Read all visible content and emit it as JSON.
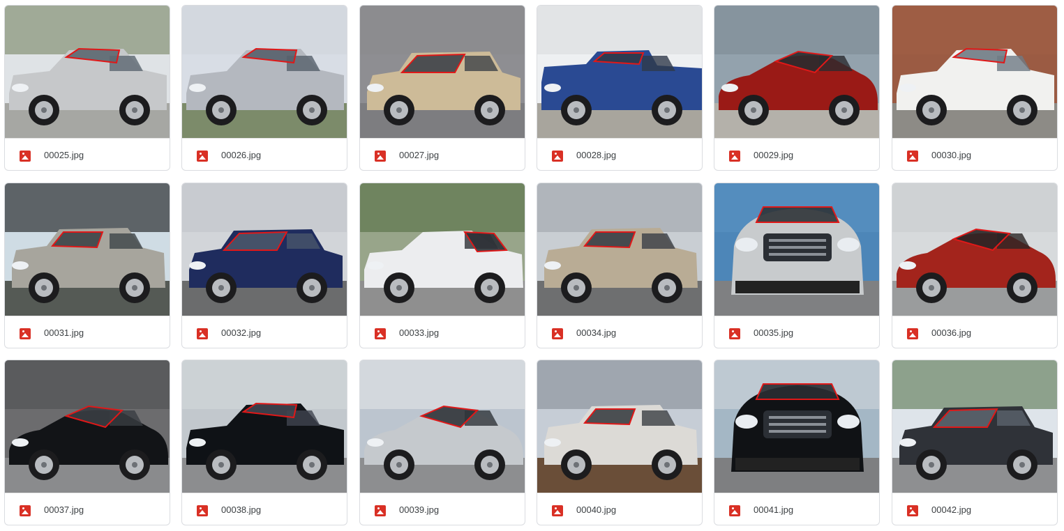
{
  "files": [
    {
      "name": "00025.jpg",
      "file_icon": "image-file-icon",
      "scene": {
        "sky": "#dfe3e6",
        "ground": "#a6a7a3",
        "body": "#c6c8ca",
        "glass": "#5b6770",
        "kind": "sedan",
        "bg": "#6c7b55"
      }
    },
    {
      "name": "00026.jpg",
      "file_icon": "image-file-icon",
      "scene": {
        "sky": "#d8dde5",
        "ground": "#7c8b6a",
        "body": "#b4b8bf",
        "glass": "#56606c",
        "kind": "sedan",
        "bg": "#cfd4da"
      }
    },
    {
      "name": "00027.jpg",
      "file_icon": "image-file-icon",
      "scene": {
        "sky": "#8e8e92",
        "ground": "#7d7d80",
        "body": "#cdbb98",
        "glass": "#3e4349",
        "kind": "hatch",
        "bg": "#8a8a8d"
      }
    },
    {
      "name": "00028.jpg",
      "file_icon": "image-file-icon",
      "scene": {
        "sky": "#eef0f2",
        "ground": "#a8a59d",
        "body": "#2a4a93",
        "glass": "#2f3a4a",
        "kind": "truck",
        "bg": "#d9dbdc"
      }
    },
    {
      "name": "00029.jpg",
      "file_icon": "image-file-icon",
      "scene": {
        "sky": "#93a2ad",
        "ground": "#b4b1aa",
        "body": "#9a1a16",
        "glass": "#2a2b2e",
        "kind": "sport",
        "bg": "#7c8891"
      }
    },
    {
      "name": "00030.jpg",
      "file_icon": "image-file-icon",
      "scene": {
        "sky": "#9b5b43",
        "ground": "#8d8b86",
        "body": "#f1f1ef",
        "glass": "#6f7b84",
        "kind": "sedan",
        "bg": "#a05e45"
      }
    },
    {
      "name": "00031.jpg",
      "file_icon": "image-file-icon",
      "scene": {
        "sky": "#cfdce4",
        "ground": "#555a55",
        "body": "#a7a59d",
        "glass": "#3d4548",
        "kind": "suv",
        "bg": "#000000"
      }
    },
    {
      "name": "00032.jpg",
      "file_icon": "image-file-icon",
      "scene": {
        "sky": "#d2d5d9",
        "ground": "#6b6c6d",
        "body": "#1f2c5e",
        "glass": "#49566a",
        "kind": "hatch",
        "bg": "#bfc3c8"
      }
    },
    {
      "name": "00033.jpg",
      "file_icon": "image-file-icon",
      "scene": {
        "sky": "#98a58a",
        "ground": "#8f8f8f",
        "body": "#ecedef",
        "glass": "#2e3136",
        "kind": "coupe",
        "bg": "#4f6a3d"
      }
    },
    {
      "name": "00034.jpg",
      "file_icon": "image-file-icon",
      "scene": {
        "sky": "#c9ced3",
        "ground": "#6e6f70",
        "body": "#b9ac95",
        "glass": "#3a3f46",
        "kind": "suv",
        "bg": "#9aa1a8"
      }
    },
    {
      "name": "00035.jpg",
      "file_icon": "image-file-icon",
      "scene": {
        "sky": "#4d86b8",
        "ground": "#7f8082",
        "body": "#c8cbcd",
        "glass": "#2f3439",
        "kind": "front",
        "bg": "#5b93c2"
      }
    },
    {
      "name": "00036.jpg",
      "file_icon": "image-file-icon",
      "scene": {
        "sky": "#d7dadc",
        "ground": "#9a9c9d",
        "body": "#a3241c",
        "glass": "#2a2526",
        "kind": "sport",
        "bg": "#c8ccce"
      }
    },
    {
      "name": "00037.jpg",
      "file_icon": "image-file-icon",
      "scene": {
        "sky": "#6c6c6e",
        "ground": "#8a8b8d",
        "body": "#121417",
        "glass": "#3a3d42",
        "kind": "roadster",
        "bg": "#4d4e50"
      }
    },
    {
      "name": "00038.jpg",
      "file_icon": "image-file-icon",
      "scene": {
        "sky": "#c2c8cd",
        "ground": "#8c8d8f",
        "body": "#0f1216",
        "glass": "#404550",
        "kind": "sedan",
        "bg": "#d6dadd"
      }
    },
    {
      "name": "00039.jpg",
      "file_icon": "image-file-icon",
      "scene": {
        "sky": "#bcc5cf",
        "ground": "#8d8e90",
        "body": "#c5c9cd",
        "glass": "#30343a",
        "kind": "sport",
        "bg": "#e5e7ea"
      }
    },
    {
      "name": "00040.jpg",
      "file_icon": "image-file-icon",
      "scene": {
        "sky": "#c6cdd6",
        "ground": "#6a4e38",
        "body": "#dcdad6",
        "glass": "#3b3f44",
        "kind": "suv",
        "bg": "#7f8790"
      }
    },
    {
      "name": "00041.jpg",
      "file_icon": "image-file-icon",
      "scene": {
        "sky": "#a4b7c5",
        "ground": "#7e7f81",
        "body": "#101215",
        "glass": "#2a2d32",
        "kind": "front",
        "bg": "#d3d8dc"
      }
    },
    {
      "name": "00042.jpg",
      "file_icon": "image-file-icon",
      "scene": {
        "sky": "#dee4ea",
        "ground": "#8e8f91",
        "body": "#2f3238",
        "glass": "#5b636d",
        "kind": "hatch",
        "bg": "#4b6a3e"
      }
    }
  ],
  "colors": {
    "card_border": "#dadce0",
    "icon_red": "#d93025",
    "label_text": "#3c4043",
    "annotation": "#e01818"
  }
}
